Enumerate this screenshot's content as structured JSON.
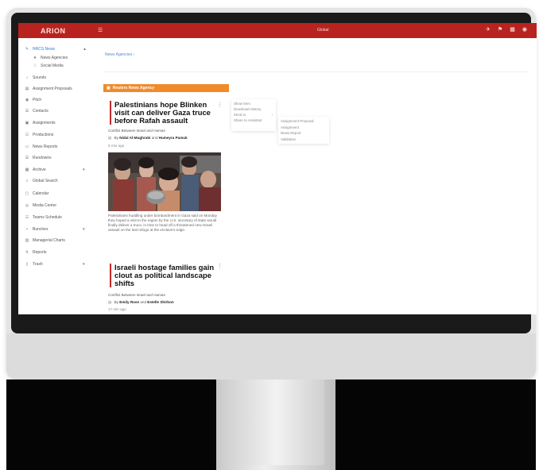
{
  "app": {
    "brand": "ARION",
    "global_search": "Global",
    "top_icons": [
      "pin-icon",
      "flag-icon",
      "grid-icon",
      "user-avatar-icon"
    ]
  },
  "sidebar": {
    "items": [
      {
        "label": "NRCS News",
        "icon": "news-icon",
        "active": true,
        "chevron": true
      },
      {
        "label": "News Agencies",
        "icon": "star-icon",
        "sub": true
      },
      {
        "label": "Social Media",
        "icon": "share-icon",
        "sub": true
      },
      {
        "label": "Sounds",
        "icon": "music-icon"
      },
      {
        "label": "Assignment Proposals",
        "icon": "proposal-icon"
      },
      {
        "label": "Pitch",
        "icon": "pitch-icon"
      },
      {
        "label": "Contacts",
        "icon": "contacts-icon"
      },
      {
        "label": "Assignments",
        "icon": "assignments-icon"
      },
      {
        "label": "Productions",
        "icon": "productions-icon"
      },
      {
        "label": "News Reports",
        "icon": "reports-icon"
      },
      {
        "label": "Rundowns",
        "icon": "rundowns-icon"
      },
      {
        "label": "Archive",
        "icon": "archive-icon",
        "chevron": true
      },
      {
        "label": "Global Search",
        "icon": "search-icon"
      },
      {
        "label": "Calendar",
        "icon": "calendar-icon"
      },
      {
        "label": "Media Center",
        "icon": "media-icon"
      },
      {
        "label": "Teams Schedule",
        "icon": "schedule-icon"
      },
      {
        "label": "Bunches",
        "icon": "bunches-icon",
        "chevron": true
      },
      {
        "label": "Managerial Charts",
        "icon": "charts-icon"
      },
      {
        "label": "Reports",
        "icon": "report-icon"
      },
      {
        "label": "Trash",
        "icon": "trash-icon",
        "chevron": true
      }
    ]
  },
  "main": {
    "breadcrumb": "News Agencies",
    "column_title": "Reuters News Agency",
    "articles": [
      {
        "title": "Palestinians hope Blinken visit can deliver Gaza truce before Rafah assault",
        "category": "Conflict Between Israel and Hamas",
        "by": "By",
        "author1": "Nidal Al-Mughrabi",
        "and": "and",
        "author2": "Humeyra Pamuk",
        "time": "6 min ago",
        "caption": "Palestinians huddling under bombardment in Gaza said on Monday they hoped a visit to the region by the U.S. secretary of state would finally deliver a truce, in time to head off a threatened new Israeli assault on the last refuge at the enclave's edge."
      },
      {
        "title": "Israeli hostage families gain clout as political landscape shifts",
        "category": "Conflict Between Israel and Hamas",
        "by": "By",
        "author1": "Emily Rose",
        "and": "and",
        "author2": "Estelle Shirbon",
        "time": "17 min ago"
      }
    ],
    "context_menu": [
      "Show Item",
      "Download History",
      "Send to",
      "Share to Assistant"
    ],
    "submenu": [
      "Assignment Proposal",
      "Assignment",
      "News Report",
      "Validation"
    ]
  }
}
